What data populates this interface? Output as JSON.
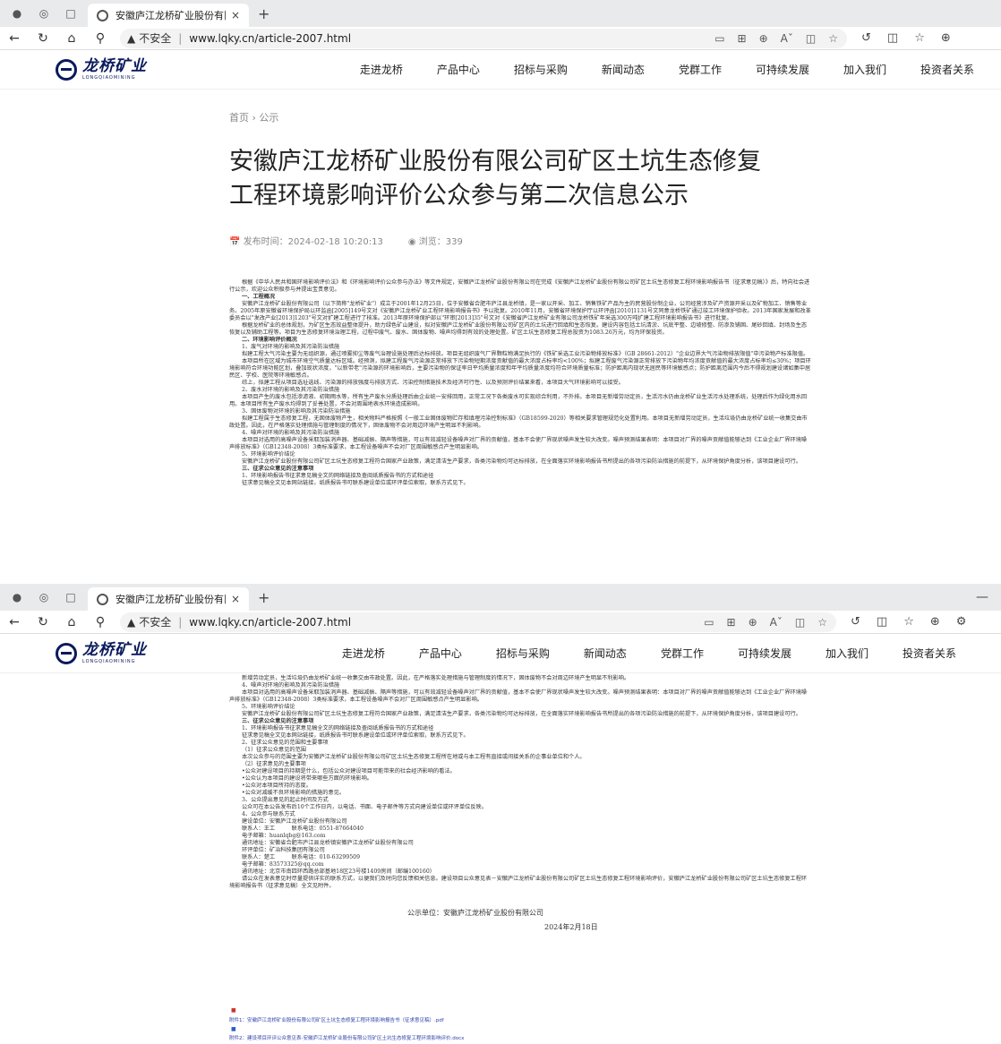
{
  "browser": {
    "tab_title": "安徽庐江龙桥矿业股份有限公司",
    "tab_close": "×",
    "new_tab": "+",
    "insecure_label": "不安全",
    "separator": "|",
    "url": "www.lqky.cn/article-2007.html",
    "url_prefix_icon": "▲"
  },
  "site": {
    "logo_cn": "龙桥矿业",
    "logo_en": "LONGQIAOMINING",
    "nav": [
      "走进龙桥",
      "产品中心",
      "招标与采购",
      "新闻动态",
      "党群工作",
      "可持续发展",
      "加入我们",
      "投资者关系"
    ]
  },
  "article": {
    "breadcrumb_home": "首页",
    "breadcrumb_sep": "›",
    "breadcrumb_current": "公示",
    "title_line1": "安徽庐江龙桥矿业股份有限公司矿区土坑生态修复",
    "title_line2": "工程环境影响评价公众参与第二次信息公示",
    "publish_label": "发布时间：2024-02-18 10:20:13",
    "views_label": "浏览：339"
  },
  "body1": [
    {
      "t": "根据《中华人民共和国环境影响评价法》和《环境影响评价公众参与办法》等文件规定，安徽庐江龙桥矿业股份有限公司在完成《安徽庐江龙桥矿业股份有限公司矿区土坑生态修复工程环境影响报告书（征求意见稿）》后，特向社会进行公示，欢迎公众积极参与并提出宝贵意见。",
      "b": false
    },
    {
      "t": "一、工程概况",
      "b": true
    },
    {
      "t": "安徽庐江龙桥矿业股份有限公司（以下简称\"龙桥矿业\"）成立于2001年12月25日，位于安徽省合肥市庐江县龙桥镇，是一家以开采、加工、销售铁矿产品为主的民营股份制企业，公司经营涉及矿产资源开采以及矿物加工、销售等业务。2005年原安徽省环境保护局以环监函[2005]149号文对《安徽庐江龙桥矿业工程环境影响报告书》予以批复。2010年11月，安徽省环境保护厅以环评函[2010]1131号文同意龙桥铁矿通过竣工环境保护验收。2013年国家发展和改革委员会以\"发改产业[2013]1203\"号文对扩建工程进行了核准。2013年原环境保护部以\"环审[2013]35\"号文对《安徽省庐江龙桥矿业有限公司龙桥铁矿年采选300万吨扩建工程环境影响报告书》进行批复。",
      "b": false
    },
    {
      "t": "根据龙桥矿业的总体规划，为矿区生态效益整体提升，助力绿色矿山建设，拟对安徽庐江龙桥矿业股份有限公司矿区内的土坑进行回填和生态恢复。建设内容包括土坑清淤、坑底平整、边坡修整、防渗及铺固、尾砂回填、封场及生态恢复以及辅助工程等。项目为生态修复环境治理工程，过程中废气、废水、固体废物、噪声均得到有效的处理处置。矿区土坑生态修复工程总投资为1083.26万元，均为环保投资。",
      "b": false
    },
    {
      "t": "二、环境影响评价概况",
      "b": true
    },
    {
      "t": "1、废气对环境的影响及其污染防治措施",
      "b": false
    },
    {
      "t": "拟建工程大气污染主要为无组织源，通过喷雾抑尘等废气治理设施处理后达标排放。项目无组织废气厂界颗粒物满足执行的《铁矿采选工业污染物排放标准》（GB 28661-2012）\"企业边界大气污染物排放限值\"中污染物产标准限值。",
      "b": false
    },
    {
      "t": "本项目所在区域为城市环境空气质量达标区域。经预测，拟建工程废气污染源正常排放下污染物短期浓度贡献值的最大浓度占标率均<100%；拟建工程废气污染源正常排放下污染物年均浓度贡献值的最大浓度占标率均≤30%；项目环境影响符合环境功能区划，叠加现状浓度，\"以新带老\"污染源的环境影响后，主要污染物的保证率日平均质量浓度和年平均质量浓度均符合环境质量标准；防护距离内现状无居民等环境敏感点；防护距离范围内今后不得规划建设诸如集中居民区、学校、医院等环境敏感点。",
      "b": false
    },
    {
      "t": "综上，拟建工程从项目选址选线、污染源的排放强度与排放方式、污染控制措施技术及经济可行性、以及预测评价结果来看，本项目大气环境影响可以接受。",
      "b": false
    },
    {
      "t": "2、废水对环境的影响及其污染防治措施",
      "b": false
    },
    {
      "t": "本项目产生的废水包括渗滤液、初期雨水等，所有生产废水分质处理后由企业统一安排回用，正常工况下各类废水可实现综合利用，不外排。本项目无新增劳动定员，生活污水仍由龙桥矿业生活污水处理系统，处理后作为绿化用水回用。本项目所有生产废水均得到了妥善处置，不会对周围地表水环境造成影响。",
      "b": false
    },
    {
      "t": "3、固体废物对环境的影响及其污染防治措施",
      "b": false
    },
    {
      "t": "拟建工程属于生态修复工程，无固体废物产生，相关物料严格按照《一般工业固体废物贮存和填埋污染控制标准》（GB18599-2020）等相关要求管理规范化处置利用。本项目无新增劳动定员，生活垃圾仍由龙桥矿业统一收集交由市政处置。因此，在严格落实处理措施与管理制度的情况下，固体废物不会对周边环境产生明显不利影响。",
      "b": false
    },
    {
      "t": "4、噪声对环境的影响及其污染防治措施",
      "b": false
    },
    {
      "t": "本项目对选用的高噪声设备采取加装消声器、基础减振、隔声等措施，可以有效减轻设备噪声对厂界的贡献值，基本不会使厂界现状噪声发生较大改变。噪声预测结果表明：本项目对厂界的噪声贡献值能够达到《工业企业厂界环境噪声排放标准》（GB12348-2008）3类标准要求，本工程设备噪声不会对厂区周围敏感点产生明显影响。",
      "b": false
    },
    {
      "t": "5、环境影响评价结论",
      "b": false
    },
    {
      "t": "安徽庐江龙桥矿业股份有限公司矿区土坑生态修复工程符合国家产业政策，满足清洁生产要求，各类污染物均可达标排放，在全面落实环境影响报告书所提出的各项污染防治措施的前提下，从环境保护角度分析，该项目建设可行。",
      "b": false
    },
    {
      "t": "三、征求公众意见的注意事项",
      "b": true
    },
    {
      "t": "1、环境影响报告书征求意见稿全文的网络链接及查阅纸质报告书的方式和途径",
      "b": false
    },
    {
      "t": "征求意见稿全文见本网站链接，纸质报告书可联系建设单位或环评单位索取，联系方式见下。",
      "b": false
    }
  ],
  "body2": [
    {
      "t": "新增劳动定员，生活垃圾仍由龙桥矿业统一收集交由市政处置。因此，在严格落实处理措施与管理制度的情况下，固体废物不会对周边环境产生明显不利影响。",
      "b": false
    },
    {
      "t": "4、噪声对环境的影响及其污染防治措施",
      "b": false
    },
    {
      "t": "本项目对选用的高噪声设备采取加装消声器、基础减振、隔声等措施，可以有效减轻设备噪声对厂界的贡献值，基本不会使厂界现状噪声发生较大改变。噪声预测结果表明：本项目对厂界的噪声贡献值能够达到《工业企业厂界环境噪声排放标准》（GB12348-2008）3类标准要求，本工程设备噪声不会对厂区周围敏感点产生明显影响。",
      "b": false
    },
    {
      "t": "5、环境影响评价结论",
      "b": false
    },
    {
      "t": "安徽庐江龙桥矿业股份有限公司矿区土坑生态修复工程符合国家产业政策，满足清洁生产要求，各类污染物均可达标排放，在全面落实环境影响报告书所提出的各项污染防治措施的前提下，从环境保护角度分析，该项目建设可行。",
      "b": false
    },
    {
      "t": "三、征求公众意见的注意事项",
      "b": true
    },
    {
      "t": "1、环境影响报告书征求意见稿全文的网络链接及查阅纸质报告书的方式和途径",
      "b": false
    },
    {
      "t": "征求意见稿全文见本网站链接，纸质报告书可联系建设单位或环评单位索取，联系方式见下。",
      "b": false
    },
    {
      "t": "2、征求公众意见的范围和主要事项",
      "b": false
    },
    {
      "t": "（1）征求公众意见的范围",
      "b": false
    },
    {
      "t": "本次公众参与的范围主要为安徽庐江龙桥矿业股份有限公司矿区土坑生态修复工程所在地或与本工程有直接或间接关系的企事业单位和个人。",
      "b": false
    },
    {
      "t": "（2）征求意见的主要事项",
      "b": false
    },
    {
      "t": "•公众对建设项目的持期是什么，包括公众对建设项目可能带来的社会经济影响的看法。",
      "b": false
    },
    {
      "t": "•公众认为本项目的建设将带来哪些方面的环境影响。",
      "b": false
    },
    {
      "t": "•公众对本项目所持的态度。",
      "b": false
    },
    {
      "t": "•公众对减缓不良环境影响的措施的意见。",
      "b": false
    },
    {
      "t": "3、公众提出意见的起止时间及方式",
      "b": false
    },
    {
      "t": "公众可在本公告发布后10个工作日内，以电话、书面、电子邮件等方式向建设单位或环评单位反映。",
      "b": false
    },
    {
      "t": "4、公众参与联系方式",
      "b": false
    },
    {
      "t": "建设单位：安徽庐江龙桥矿业股份有限公司",
      "b": false
    },
    {
      "t": "联系人：王工　　　联系电话：0551-87664040",
      "b": false
    },
    {
      "t": "电子邮箱：huanlqbg@163.com",
      "b": false
    },
    {
      "t": "通讯地址：安徽省合肥市庐江县龙桥镇安徽庐江龙桥矿业股份有限公司",
      "b": false
    },
    {
      "t": "环评单位：矿冶科技集团有限公司",
      "b": false
    },
    {
      "t": "联系人：楚工　　　联系电话：010-63299509",
      "b": false
    },
    {
      "t": "电子邮箱：83573325@qq.com",
      "b": false
    },
    {
      "t": "通讯地址：北京市南四环西路总部基地18区23号楼1409房间（邮编100160）",
      "b": false
    },
    {
      "t": "请公众在发表意见时尽量提供详实的联系方式，以便我们及时向您反馈相关信息。建设项目公众意见表－安徽庐江龙桥矿业股份有限公司矿区土坑生态修复工程环境影响评价，安徽庐江龙桥矿业股份有限公司矿区土坑生态修复工程环境影响报告书（征求意见稿）全文见附件。",
      "b": false
    }
  ],
  "signature": {
    "unit": "公示单位：安徽庐江龙桥矿业股份有限公司",
    "date": "2024年2月18日"
  },
  "attachments": [
    "附件1：安徽庐江龙桥矿业股份有限公司矿区土坑生态修复工程环境影响报告书（征求意见稿）.pdf",
    "附件2：建设项目环评公众意见表-安徽庐江龙桥矿业股份有限公司矿区土坑生态修复工程环境影响评价.docx"
  ]
}
